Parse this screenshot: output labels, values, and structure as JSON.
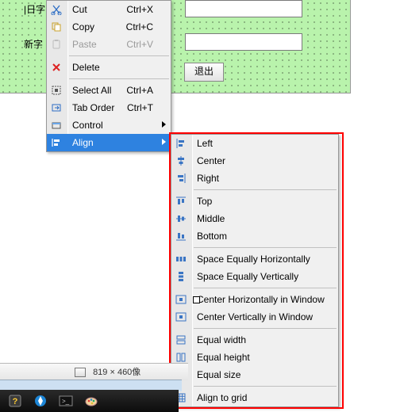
{
  "designer": {
    "label_old": "|日字",
    "label_new": "新字",
    "button_exit": "退出"
  },
  "menu": {
    "cut": {
      "label": "Cut",
      "shortcut": "Ctrl+X"
    },
    "copy": {
      "label": "Copy",
      "shortcut": "Ctrl+C"
    },
    "paste": {
      "label": "Paste",
      "shortcut": "Ctrl+V"
    },
    "delete": {
      "label": "Delete"
    },
    "select_all": {
      "label": "Select All",
      "shortcut": "Ctrl+A"
    },
    "tab_order": {
      "label": "Tab Order",
      "shortcut": "Ctrl+T"
    },
    "control": {
      "label": "Control"
    },
    "align": {
      "label": "Align"
    }
  },
  "align": {
    "left": "Left",
    "center": "Center",
    "right": "Right",
    "top": "Top",
    "middle": "Middle",
    "bottom": "Bottom",
    "space_h": "Space Equally Horizontally",
    "space_v": "Space Equally Vertically",
    "center_h_win": "Center Horizontally in Window",
    "center_v_win": "Center Vertically in Window",
    "equal_w": "Equal width",
    "equal_h": "Equal height",
    "equal_s": "Equal size",
    "grid": "Align to grid"
  },
  "status": {
    "size_text": "819 × 460像"
  }
}
